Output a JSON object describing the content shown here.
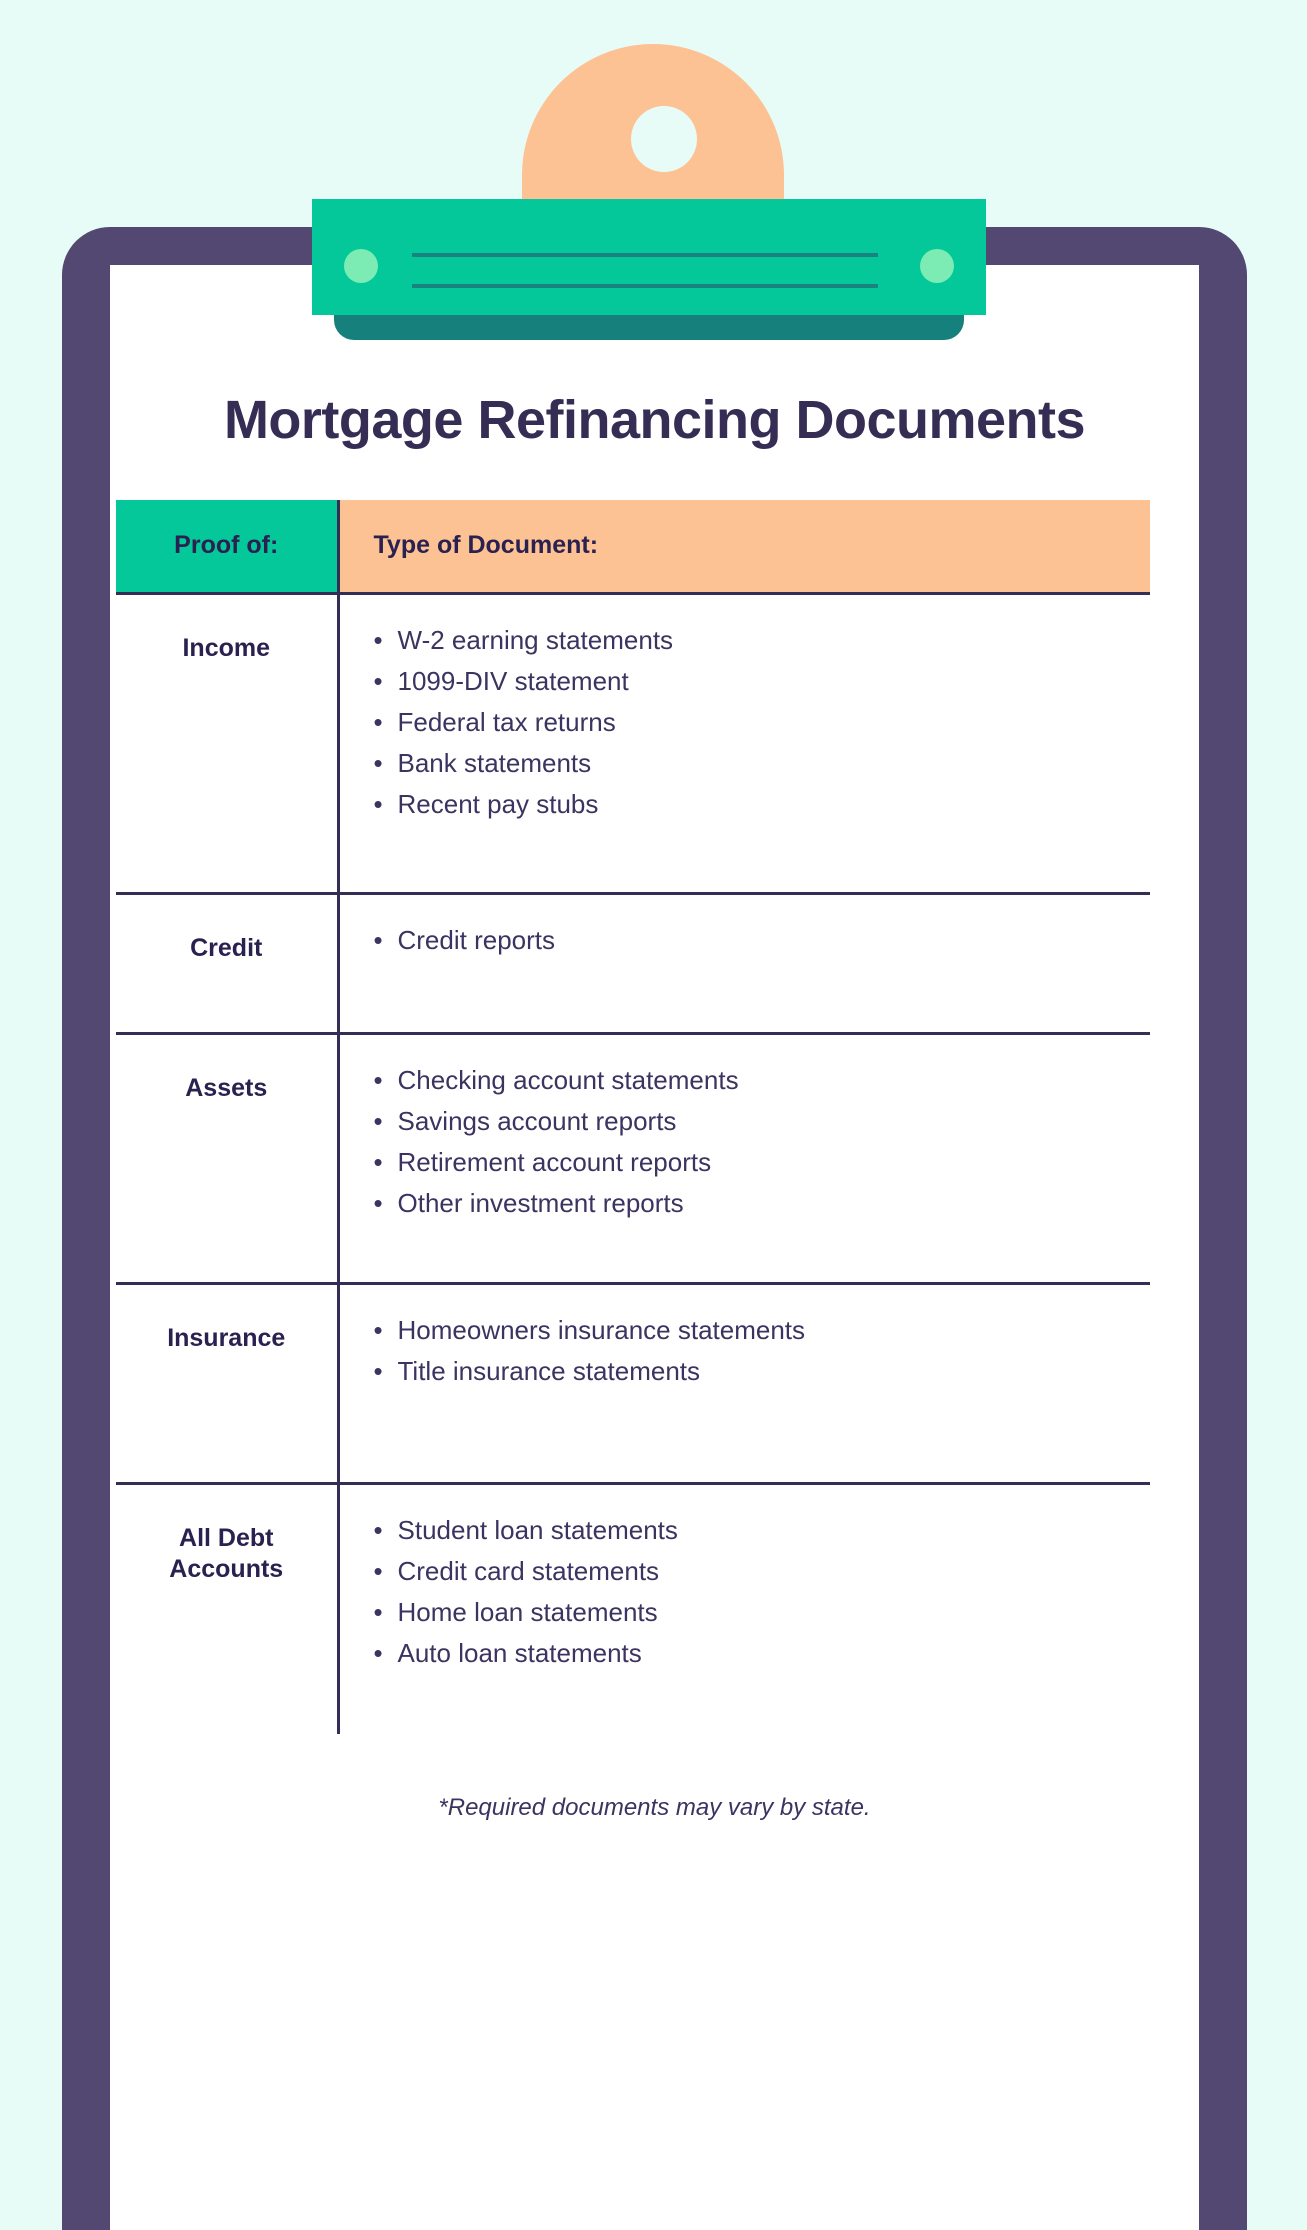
{
  "title": "Mortgage Refinancing Documents",
  "footnote": "*Required documents may vary by state.",
  "colors": {
    "background": "#e8fcf7",
    "clipboard_frame": "#534872",
    "paper": "#ffffff",
    "teal": "#04c79a",
    "teal_dark": "#16807c",
    "teal_light": "#7debb4",
    "peach": "#fcc293",
    "text_dark": "#362d54",
    "text_body": "#3c3360"
  },
  "table": {
    "headers": {
      "proof": "Proof of:",
      "type": "Type of Document:"
    },
    "rows": [
      {
        "proof": "Income",
        "documents": [
          "W-2 earning statements",
          "1099-DIV statement",
          "Federal tax returns",
          "Bank statements",
          "Recent pay stubs"
        ]
      },
      {
        "proof": "Credit",
        "documents": [
          "Credit reports"
        ]
      },
      {
        "proof": "Assets",
        "documents": [
          "Checking account statements",
          "Savings account reports",
          "Retirement account reports",
          "Other investment reports"
        ]
      },
      {
        "proof": "Insurance",
        "documents": [
          "Homeowners insurance statements",
          "Title insurance statements"
        ]
      },
      {
        "proof": "All Debt Accounts",
        "documents": [
          "Student loan statements",
          "Credit card statements",
          "Home loan statements",
          "Auto loan statements"
        ]
      }
    ]
  }
}
